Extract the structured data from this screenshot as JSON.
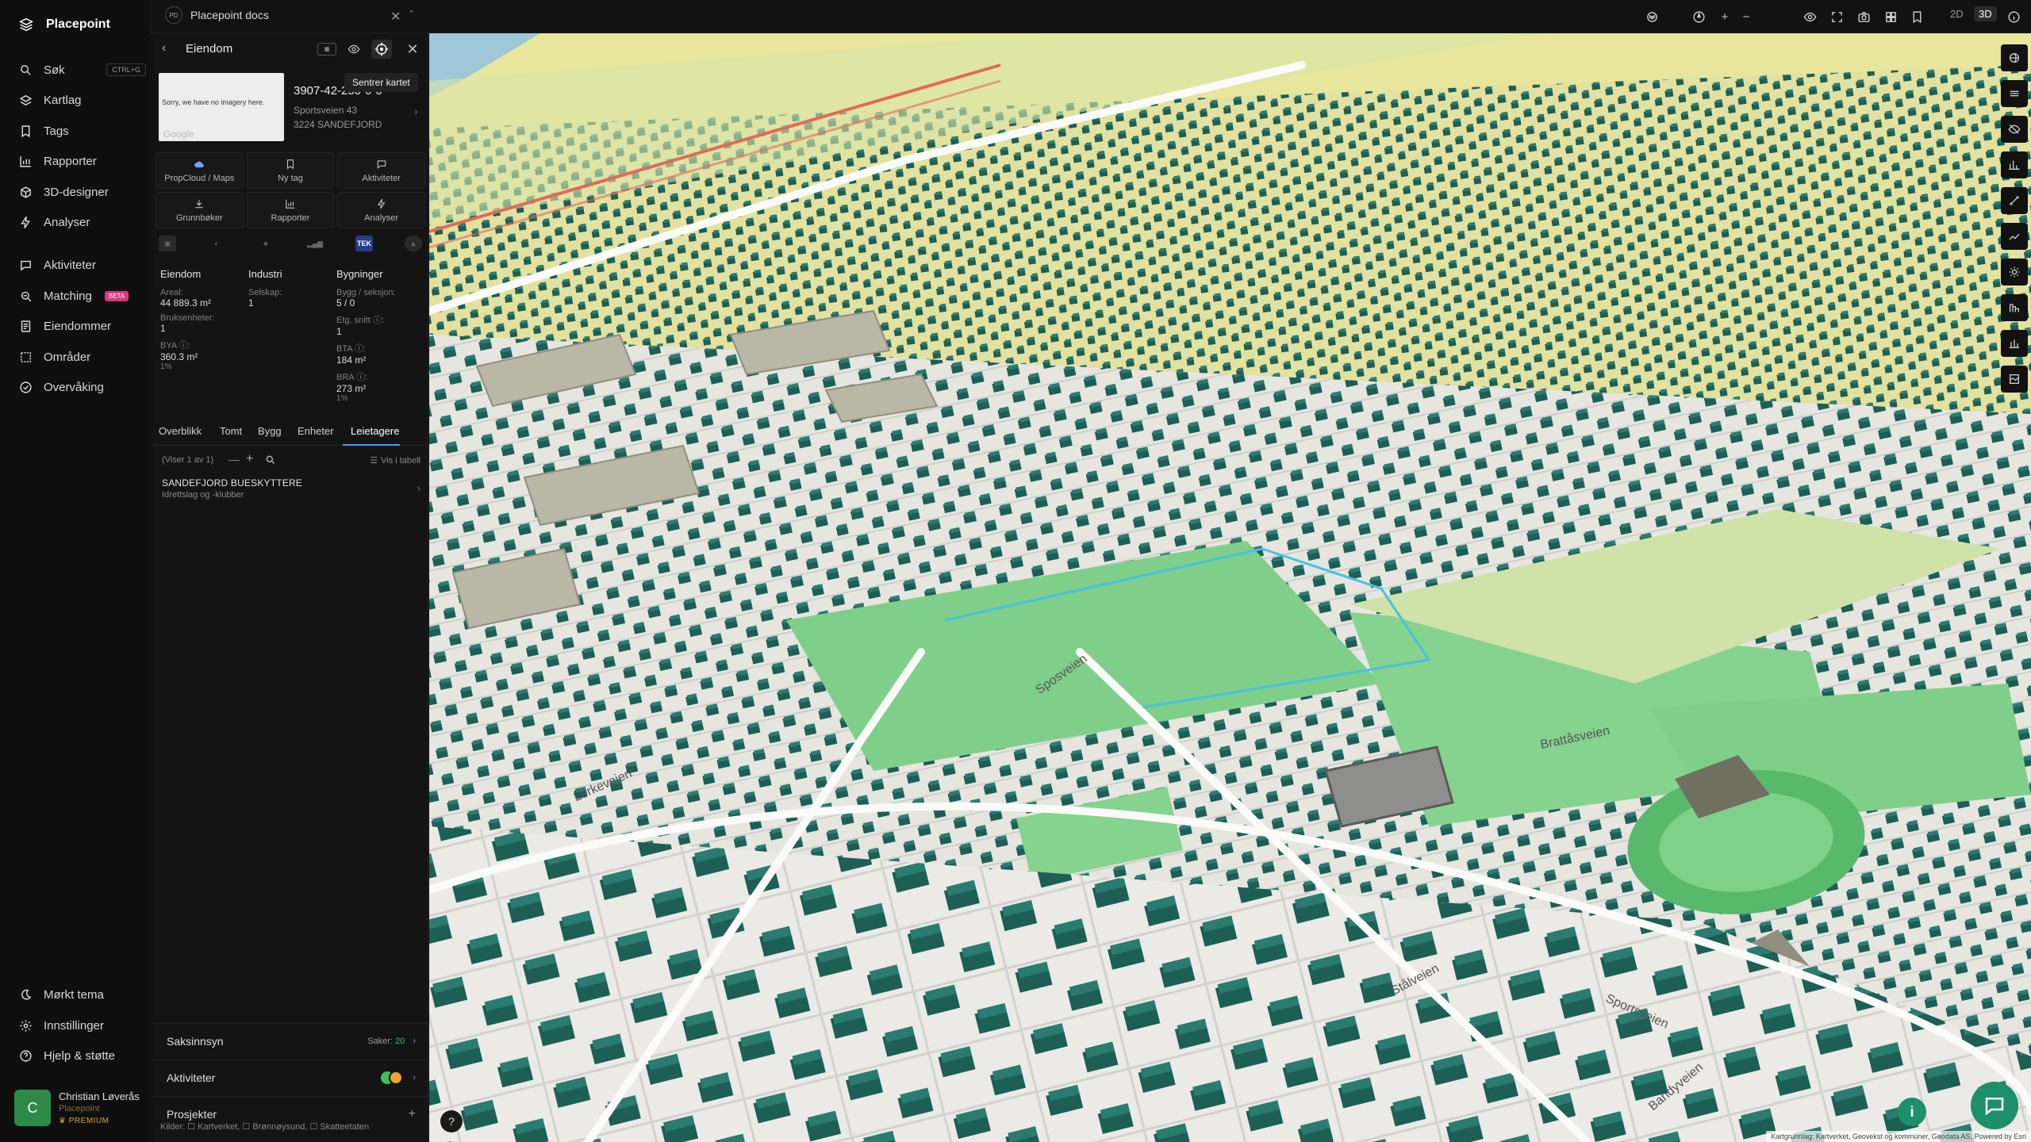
{
  "app": {
    "name": "Placepoint",
    "doc_tab": "Placepoint docs",
    "doc_badge": "PD"
  },
  "nav": {
    "items": [
      {
        "label": "Søk",
        "shortcut": "CTRL+G",
        "icon": "search-icon"
      },
      {
        "label": "Kartlag",
        "icon": "layers-icon"
      },
      {
        "label": "Tags",
        "icon": "bookmark-icon"
      },
      {
        "label": "Rapporter",
        "icon": "chart-icon"
      },
      {
        "label": "3D-designer",
        "icon": "cube-icon"
      },
      {
        "label": "Analyser",
        "icon": "bolt-icon"
      },
      {
        "label": "Aktiviteter",
        "icon": "chat-icon"
      },
      {
        "label": "Matching",
        "badge": "BETA",
        "icon": "match-icon"
      },
      {
        "label": "Eiendommer",
        "icon": "document-icon"
      },
      {
        "label": "Områder",
        "icon": "area-icon"
      },
      {
        "label": "Overvåking",
        "icon": "check-circle-icon"
      }
    ],
    "bottom": [
      {
        "label": "Mørkt tema",
        "icon": "moon-icon"
      },
      {
        "label": "Innstillinger",
        "icon": "gear-icon"
      },
      {
        "label": "Hjelp & støtte",
        "icon": "help-icon"
      }
    ],
    "user": {
      "initial": "C",
      "name": "Christian Løverås",
      "org": "Placepoint",
      "plan": "PREMIUM"
    }
  },
  "topbar": {
    "view_2d": "2D",
    "view_3d": "3D"
  },
  "panel": {
    "title": "Eiendom",
    "tooltip": "Sentrer kartet",
    "thumb_text": "Sorry, we have no imagery here.",
    "thumb_brand": "Google",
    "property_id": "3907-42-250-0-0",
    "address_line1": "Sportsveien 43",
    "address_line2": "3224 SANDEFJORD",
    "buttons": [
      {
        "label": "PropCloud / Maps",
        "icon": "cloud-icon"
      },
      {
        "label": "Ny tag",
        "icon": "bookmark-icon"
      },
      {
        "label": "Aktiviteter",
        "icon": "chat-icon"
      },
      {
        "label": "Grunnbøker",
        "icon": "download-icon"
      },
      {
        "label": "Rapporter",
        "icon": "chart-icon"
      },
      {
        "label": "Analyser",
        "icon": "bolt-icon"
      }
    ],
    "tek_label": "TEK",
    "columns": {
      "eiendom": {
        "head": "Eiendom",
        "areal_label": "Areal:",
        "areal_value": "44 889.3 m²",
        "brukse_label": "Bruksenheter:",
        "brukse_value": "1",
        "bya_label": "BYA ⓘ:",
        "bya_value": "360.3 m²",
        "bya_pct": "1%"
      },
      "industri": {
        "head": "Industri",
        "selskap_label": "Selskap:",
        "selskap_value": "1"
      },
      "bygninger": {
        "head": "Bygninger",
        "bygg_label": "Bygg / seksjon:",
        "bygg_value": "5 / 0",
        "etg_label": "Etg. snitt ⓘ:",
        "etg_value": "1",
        "bta_label": "BTA ⓘ:",
        "bta_value": "184 m²",
        "bra_label": "BRA ⓘ:",
        "bra_value": "273 m²",
        "bra_pct": "1%"
      }
    },
    "tabs": [
      "Overblikk",
      "Tomt",
      "Bygg",
      "Enheter",
      "Leietagere"
    ],
    "active_tab": "Leietagere",
    "list": {
      "showing": "(Viser 1 av 1)",
      "table_link": "Vis i tabell"
    },
    "tenant": {
      "name": "SANDEFJORD BUESKYTTERE",
      "sub": "Idrettslag og -klubber"
    },
    "sections": {
      "saksinnsyn": {
        "label": "Saksinnsyn",
        "count_label": "Saker:",
        "count": "20"
      },
      "aktiviteter": {
        "label": "Aktiviteter"
      },
      "prosjekter": {
        "label": "Prosjekter"
      }
    },
    "sources": "Kilder: ☐ Kartverket, ☐ Brønnøysund, ☐ Skatteetaten"
  },
  "map": {
    "attribution": "Kartgrunnlag: Kartverket, Geovekst og kommuner, Geodata AS, Powered by Esri",
    "street_labels": [
      "Sportsveien",
      "Stålveien",
      "Bandyveien",
      "Brattåsveien",
      "Lerkeveien",
      "Sposveien"
    ],
    "colors": {
      "building": "#1d5e55",
      "building_roof": "#2a7c70",
      "grass": "#7fcf8a",
      "field": "#e8e59c",
      "ground": "#e9e8e4",
      "accent": "#1c8f6b"
    }
  }
}
